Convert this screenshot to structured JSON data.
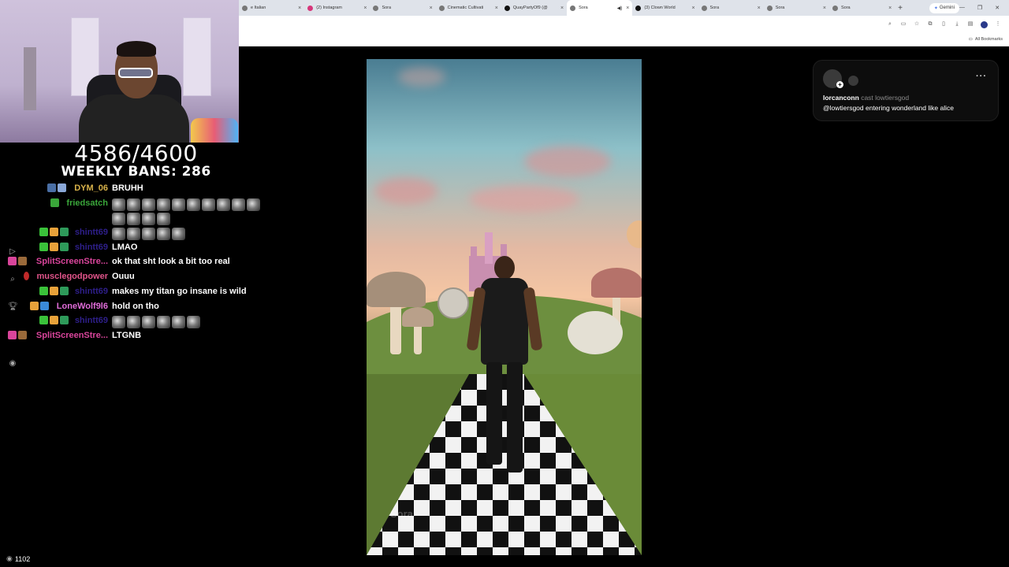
{
  "browser": {
    "tabs": [
      {
        "label": "e Italian",
        "active": false
      },
      {
        "label": "(2) Instagram",
        "active": false
      },
      {
        "label": "Sora",
        "active": false
      },
      {
        "label": "Cinematic Cultivati",
        "active": false
      },
      {
        "label": "QuayPartyOf9 (@",
        "active": false
      },
      {
        "label": "Sora",
        "active": true
      },
      {
        "label": "(3) Clown World",
        "active": false
      },
      {
        "label": "Sora",
        "active": false
      },
      {
        "label": "Sora",
        "active": false
      },
      {
        "label": "Sora",
        "active": false
      }
    ],
    "new_tab": "+",
    "gemini_label": "Gemini",
    "bookmarks_label": "All Bookmarks"
  },
  "overlay": {
    "ban_count": "4586/4600",
    "weekly_bans": "WEEKLY BANS: 286"
  },
  "chat": {
    "messages": [
      {
        "user": "DYM_06",
        "color": "#d8b24a",
        "text": "BRUHH",
        "emotes": 0
      },
      {
        "user": "friedsatch",
        "color": "#3aa63a",
        "text": "",
        "emotes": 10
      },
      {
        "user": "",
        "color": "#3aa63a",
        "text": "",
        "emotes": 4
      },
      {
        "user": "shintt69",
        "color": "#2e1f8a",
        "text": "",
        "emotes": 5
      },
      {
        "user": "shintt69",
        "color": "#2e1f8a",
        "text": "LMAO",
        "emotes": 0
      },
      {
        "user": "SplitScreenStre...",
        "color": "#d9459b",
        "text": "ok that sht look a bit too real",
        "emotes": 0
      },
      {
        "user": "musclegodpower",
        "color": "#e0548a",
        "text": "Ouuu",
        "emotes": 0
      },
      {
        "user": "shintt69",
        "color": "#2e1f8a",
        "text": "makes my titan go insane is wild",
        "emotes": 0
      },
      {
        "user": "LoneWolf9l6",
        "color": "#e06cd8",
        "text": "hold on tho",
        "emotes": 0
      },
      {
        "user": "shintt69",
        "color": "#2e1f8a",
        "text": "",
        "emotes": 6
      },
      {
        "user": "SplitScreenStre...",
        "color": "#d9459b",
        "text": "LTGNB",
        "emotes": 0
      }
    ],
    "viewer_count": "1102"
  },
  "video": {
    "watermark": "Sora"
  },
  "card": {
    "username": "lorcanconn",
    "cast_text": "cast lowtiersgod",
    "caption": "@lowtiersgod entering wonderland like alice",
    "more": "···"
  }
}
